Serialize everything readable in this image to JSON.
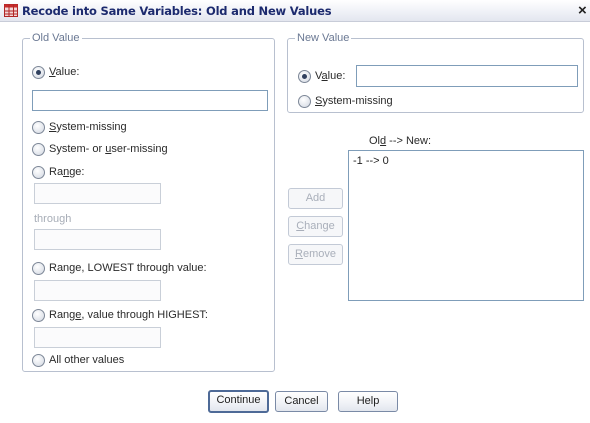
{
  "window": {
    "title": "Recode into Same Variables: Old and New Values",
    "close_glyph": "×"
  },
  "icons": {
    "app": "spss-data-grid-icon",
    "close": "close-icon"
  },
  "colors": {
    "title_text": "#1c2a6e",
    "group_title": "#6a7893",
    "disabled_text": "#a9afba",
    "field_border": "#7f9db9"
  },
  "old_value": {
    "title": "Old Value",
    "value_label": {
      "pre": "",
      "key": "V",
      "post": "alue:"
    },
    "value_input": "",
    "system_missing_label": {
      "pre": "",
      "key": "S",
      "post": "ystem-missing"
    },
    "system_or_user_missing_label": {
      "pre": "System- or ",
      "key": "u",
      "post": "ser-missing"
    },
    "range_label": {
      "pre": "Ra",
      "key": "n",
      "post": "ge:"
    },
    "range_from": "",
    "through_label": "through",
    "range_to": "",
    "range_lowest_label": "Range, LOWEST through value:",
    "range_lowest_input": "",
    "range_highest_label": {
      "pre": "Rang",
      "key": "e",
      "post": ", value through HIGHEST:"
    },
    "range_highest_input": "",
    "all_other_label": "All other values",
    "selected": "value"
  },
  "new_value": {
    "title": "New Value",
    "value_label": {
      "pre": "V",
      "key": "a",
      "post": "lue:"
    },
    "value_input": "",
    "system_missing_label": {
      "pre": "",
      "key": "S",
      "post": "ystem-missing"
    },
    "selected": "value"
  },
  "mapping": {
    "heading": {
      "pre": "Ol",
      "key": "d",
      "post": " --> New:"
    },
    "items": [
      "-1 --> 0"
    ],
    "add_label": "Add",
    "change_label": {
      "pre": "",
      "key": "C",
      "post": "hange"
    },
    "remove_label": {
      "pre": "",
      "key": "R",
      "post": "emove"
    }
  },
  "footer": {
    "continue_label": "Continue",
    "cancel_label": "Cancel",
    "help_label": "Help"
  }
}
